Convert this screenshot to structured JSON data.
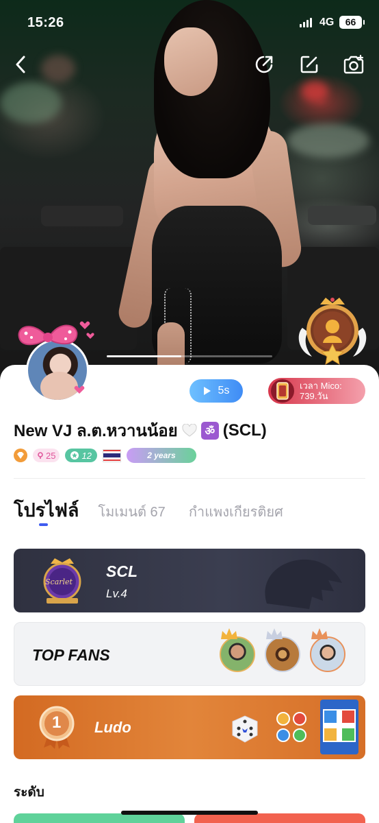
{
  "status_bar": {
    "time": "15:26",
    "network": "4G",
    "battery": "66"
  },
  "topbar": {
    "icons": [
      "back-icon",
      "share-icon",
      "edit-icon",
      "camera-icon"
    ]
  },
  "photo_carousel": {
    "progress": 0.45
  },
  "profile": {
    "video_duration": "5s",
    "mico_time_line1": "เวลา Mico:",
    "mico_time_line2": "739.วัน",
    "name": "New VJ ล.ต.หวานน้อย",
    "name_emoji_heart": "🤍",
    "name_emoji_om": "ॐ",
    "name_suffix": "(SCL)",
    "badges": {
      "fans_level": "25",
      "star_level": "12",
      "country": "Thailand",
      "years": "2 years"
    }
  },
  "tabs": [
    {
      "label": "โปรไฟล์"
    },
    {
      "label": "โมเมนต์ 67"
    },
    {
      "label": "กำแพงเกียรติยศ"
    }
  ],
  "family_card": {
    "title": "SCL",
    "level": "Lv.4",
    "emblem_text": "Scarlet"
  },
  "fans_card": {
    "title": "TOP FANS"
  },
  "ludo_card": {
    "rank": "1",
    "title": "Ludo"
  },
  "section": {
    "level_title": "ระดับ"
  },
  "colors": {
    "accent_blue": "#3f5cf0",
    "family_card_bg": "#2f3140",
    "ludo_card_bg": "#d36a22",
    "mico_pill": "#d7364b"
  }
}
